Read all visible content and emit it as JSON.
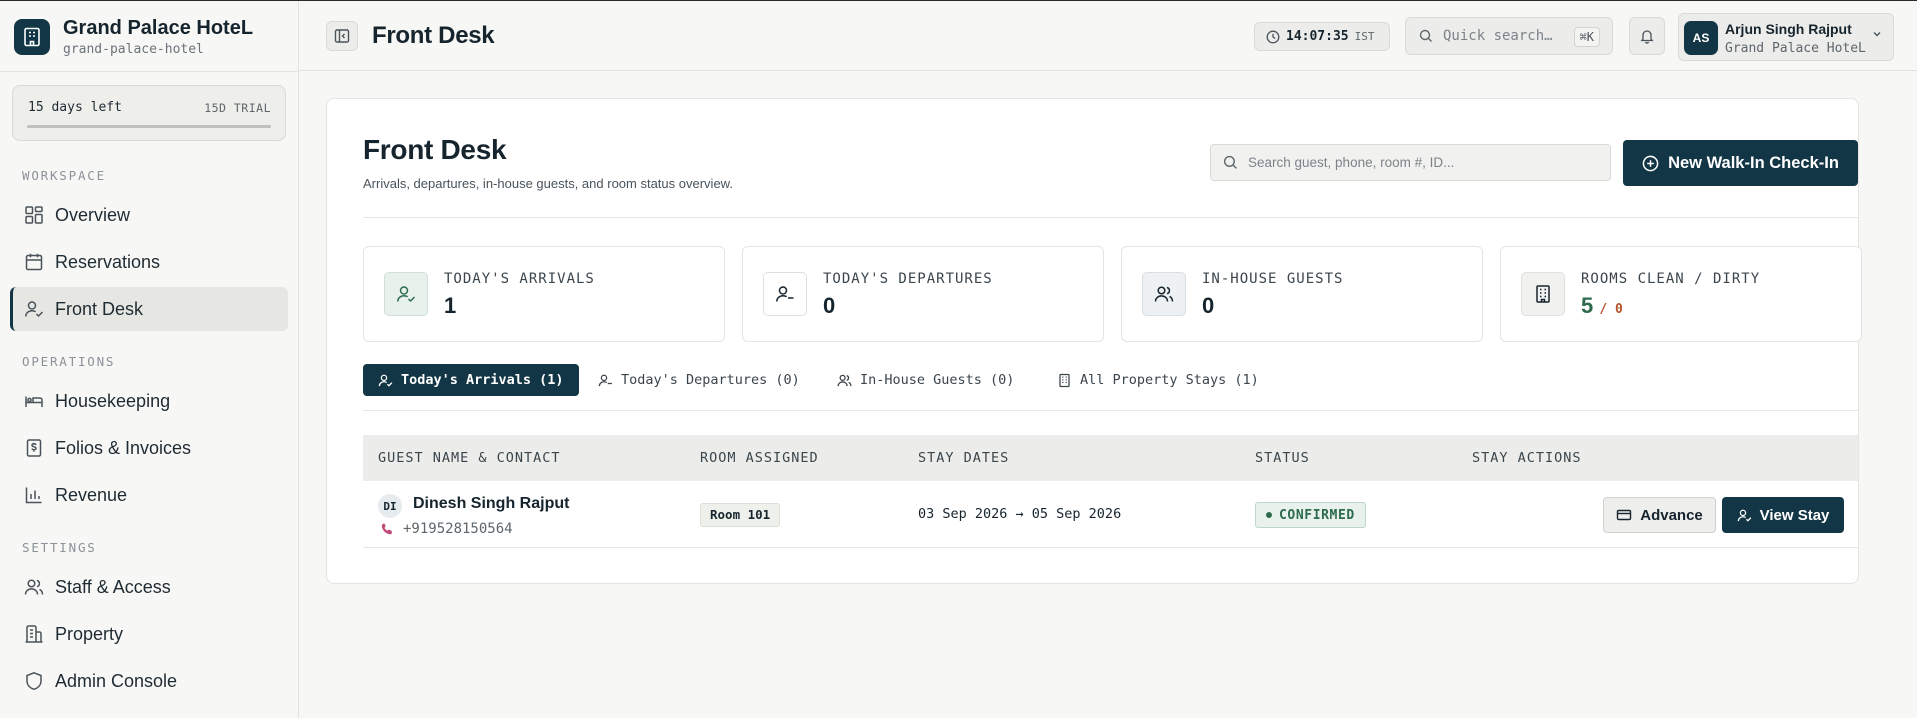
{
  "sidebar": {
    "brand_name": "Grand Palace HoteL",
    "brand_slug": "grand-palace-hotel",
    "trial": {
      "days_left": "15 days left",
      "badge": "15D TRIAL",
      "progress": 1.0
    },
    "sections": {
      "workspace": "WORKSPACE",
      "operations": "OPERATIONS",
      "settings": "SETTINGS"
    },
    "items": [
      {
        "label": "Overview",
        "icon": "grid-icon"
      },
      {
        "label": "Reservations",
        "icon": "calendar-icon"
      },
      {
        "label": "Front Desk",
        "icon": "user-check-icon",
        "active": true
      },
      {
        "label": "Housekeeping",
        "icon": "bed-icon"
      },
      {
        "label": "Folios & Invoices",
        "icon": "receipt-icon"
      },
      {
        "label": "Revenue",
        "icon": "bar-chart-icon"
      },
      {
        "label": "Staff & Access",
        "icon": "users-icon"
      },
      {
        "label": "Property",
        "icon": "building-icon"
      },
      {
        "label": "Admin Console",
        "icon": "shield-icon"
      }
    ]
  },
  "header": {
    "title": "Front Desk",
    "clock_time": "14:07:35",
    "clock_zone": "IST",
    "quick_search_placeholder": "Quick search…",
    "quick_search_shortcut": "⌘K",
    "user_initials": "AS",
    "user_name": "Arjun Singh Rajput",
    "user_property": "Grand Palace HoteL"
  },
  "page": {
    "title": "Front Desk",
    "subtitle": "Arrivals, departures, in-house guests, and room status overview.",
    "search_placeholder": "Search guest, phone, room #, ID...",
    "walkin_label": "New Walk-In Check-In"
  },
  "stats": [
    {
      "label": "TODAY'S ARRIVALS",
      "value": "1",
      "icon": "user-check-icon"
    },
    {
      "label": "TODAY'S DEPARTURES",
      "value": "0",
      "icon": "user-minus-icon"
    },
    {
      "label": "IN-HOUSE GUESTS",
      "value": "0",
      "icon": "users-icon"
    },
    {
      "label": "ROOMS CLEAN / DIRTY",
      "clean": "5",
      "dirty": "/ 0",
      "icon": "building-icon"
    }
  ],
  "tabs": [
    {
      "label": "Today's Arrivals (1)",
      "active": true
    },
    {
      "label": "Today's Departures (0)"
    },
    {
      "label": "In-House Guests (0)"
    },
    {
      "label": "All Property Stays (1)"
    }
  ],
  "table": {
    "columns": [
      "GUEST NAME & CONTACT",
      "ROOM ASSIGNED",
      "STAY DATES",
      "STATUS",
      "STAY ACTIONS"
    ],
    "rows": [
      {
        "initials": "DI",
        "name": "Dinesh Singh Rajput",
        "phone": "+919528150564",
        "room": "Room 101",
        "dates": "03 Sep 2026 → 05 Sep 2026",
        "status": "CONFIRMED",
        "advance_label": "Advance",
        "view_label": "View Stay"
      }
    ]
  },
  "colors": {
    "primary": "#123645",
    "clean": "#2e6b4d",
    "dirty": "#b4532a",
    "phone_icon": "#c04a7a"
  }
}
